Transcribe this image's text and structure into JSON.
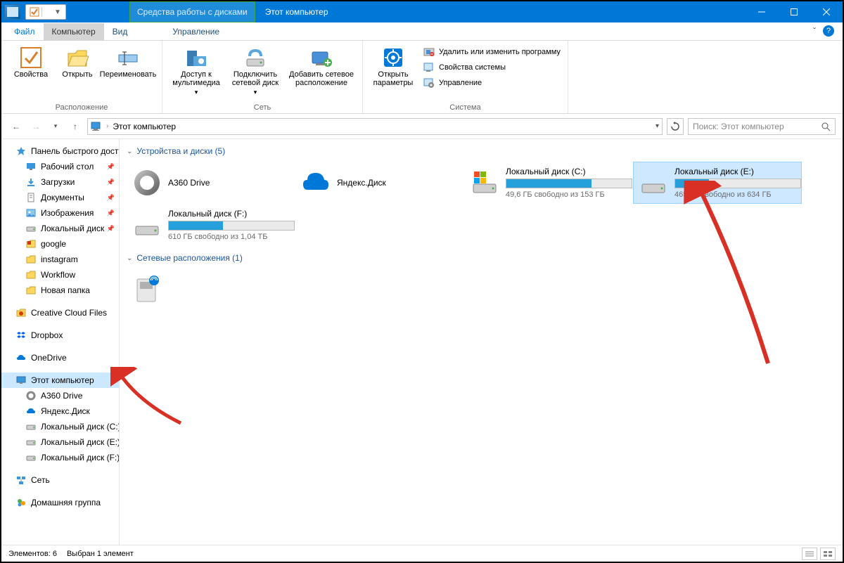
{
  "titlebar": {
    "context_tab": "Средства работы с дисками",
    "title": "Этот компьютер"
  },
  "ribbon_tabs": {
    "file": "Файл",
    "computer": "Компьютер",
    "view": "Вид",
    "manage": "Управление"
  },
  "ribbon": {
    "location": {
      "properties": "Свойства",
      "open": "Открыть",
      "rename": "Переименовать",
      "group": "Расположение"
    },
    "network": {
      "media": "Доступ к мультимедиа",
      "map_drive": "Подключить сетевой диск",
      "add_loc": "Добавить сетевое расположение",
      "group": "Сеть"
    },
    "system": {
      "open_settings": "Открыть параметры",
      "uninstall": "Удалить или изменить программу",
      "sys_props": "Свойства системы",
      "manage": "Управление",
      "group": "Система"
    }
  },
  "breadcrumb": {
    "location": "Этот компьютер"
  },
  "search": {
    "placeholder": "Поиск: Этот компьютер"
  },
  "sidebar": {
    "quick": "Панель быстрого доступа",
    "desktop": "Рабочий стол",
    "downloads": "Загрузки",
    "documents": "Документы",
    "pictures": "Изображения",
    "localdisk_short": "Локальный диск",
    "google": "google",
    "instagram": "instagram",
    "workflow": "Workflow",
    "newfolder": "Новая папка",
    "creative": "Creative Cloud Files",
    "dropbox": "Dropbox",
    "onedrive": "OneDrive",
    "thispc": "Этот компьютер",
    "a360": "A360 Drive",
    "yandex": "Яндекс.Диск",
    "diskC": "Локальный диск (C:)",
    "diskE": "Локальный диск (E:)",
    "diskF": "Локальный диск (F:)",
    "network": "Сеть",
    "homegroup": "Домашняя группа"
  },
  "content": {
    "group_devices": "Устройства и диски (5)",
    "group_network": "Сетевые расположения (1)",
    "a360": "A360 Drive",
    "yandex": "Яндекс.Диск",
    "diskC": {
      "name": "Локальный диск (C:)",
      "sub": "49,6 ГБ свободно из 153 ГБ",
      "fill": 68
    },
    "diskE": {
      "name": "Локальный диск (E:)",
      "sub": "465 ГБ свободно из 634 ГБ",
      "fill": 27
    },
    "diskF": {
      "name": "Локальный диск (F:)",
      "sub": "610 ГБ свободно из 1,04 ТБ",
      "fill": 43
    }
  },
  "status": {
    "items": "Элементов: 6",
    "selected": "Выбран 1 элемент"
  }
}
